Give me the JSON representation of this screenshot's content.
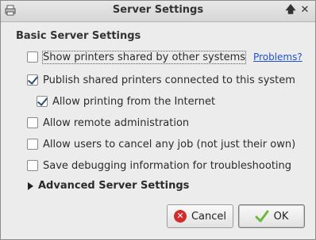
{
  "window": {
    "title": "Server Settings",
    "controls": {
      "keep_above": "🡅",
      "close": "✕"
    }
  },
  "section_title": "Basic Server Settings",
  "options": [
    {
      "label": "Show printers shared by other systems",
      "checked": false
    },
    {
      "label": "Publish shared printers connected to this system",
      "checked": true
    },
    {
      "label": "Allow printing from the Internet",
      "checked": true
    },
    {
      "label": "Allow remote administration",
      "checked": false
    },
    {
      "label": "Allow users to cancel any job (not just their own)",
      "checked": false
    },
    {
      "label": "Save debugging information for troubleshooting",
      "checked": false
    }
  ],
  "problems_link": "Problems?",
  "advanced_label": "Advanced Server Settings",
  "buttons": {
    "cancel": "Cancel",
    "ok": "OK"
  },
  "colors": {
    "accent_check": "#2a4e78",
    "link": "#1f4fd6",
    "cancel_icon": "#d32c2c",
    "ok_icon": "#6fb63c"
  },
  "icons": {
    "window_icon": "printer-icon",
    "cancel": "cancel-icon",
    "ok": "checkmark-icon",
    "expander": "expander-arrow-icon"
  }
}
